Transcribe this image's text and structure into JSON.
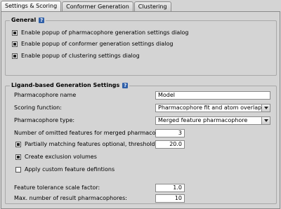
{
  "tabs": [
    {
      "label": "Settings & Scoring",
      "active": true
    },
    {
      "label": "Conformer Generation",
      "active": false
    },
    {
      "label": "Clustering",
      "active": false
    }
  ],
  "general": {
    "title": "General",
    "help_icon": "?",
    "options": [
      {
        "label": "Enable popup of pharmacophore generation settings dialog",
        "checked": true
      },
      {
        "label": "Enable popup of conformer generation settings dialog",
        "checked": true
      },
      {
        "label": "Enable popup of clustering settings dialog",
        "checked": true
      }
    ]
  },
  "ligand": {
    "title": "Ligand-based Generation Settings",
    "help_icon": "?",
    "pharmacophore_name_label": "Pharmacophore name",
    "pharmacophore_name_value": "Model",
    "scoring_label": "Scoring function:",
    "scoring_value": "Pharmacophore fit and atom overlap",
    "type_label": "Pharmacophore type:",
    "type_value": "Merged feature pharmacophore",
    "omitted_label": "Number of omitted features for merged pharmacophore:",
    "omitted_value": "3",
    "partial_label": "Partially matching features optional, threshold (%):",
    "partial_checked": true,
    "partial_value": "20.0",
    "exclusion_label": "Create exclusion volumes",
    "exclusion_checked": true,
    "custom_label": "Apply custom feature defintions",
    "custom_checked": false,
    "tolerance_label": "Feature tolerance scale factor:",
    "tolerance_value": "1.0",
    "max_label": "Max. number of result pharmacophores:",
    "max_value": "10"
  },
  "colors": {
    "background": "#d4d4d4",
    "help_icon": "#2f5fa8"
  }
}
